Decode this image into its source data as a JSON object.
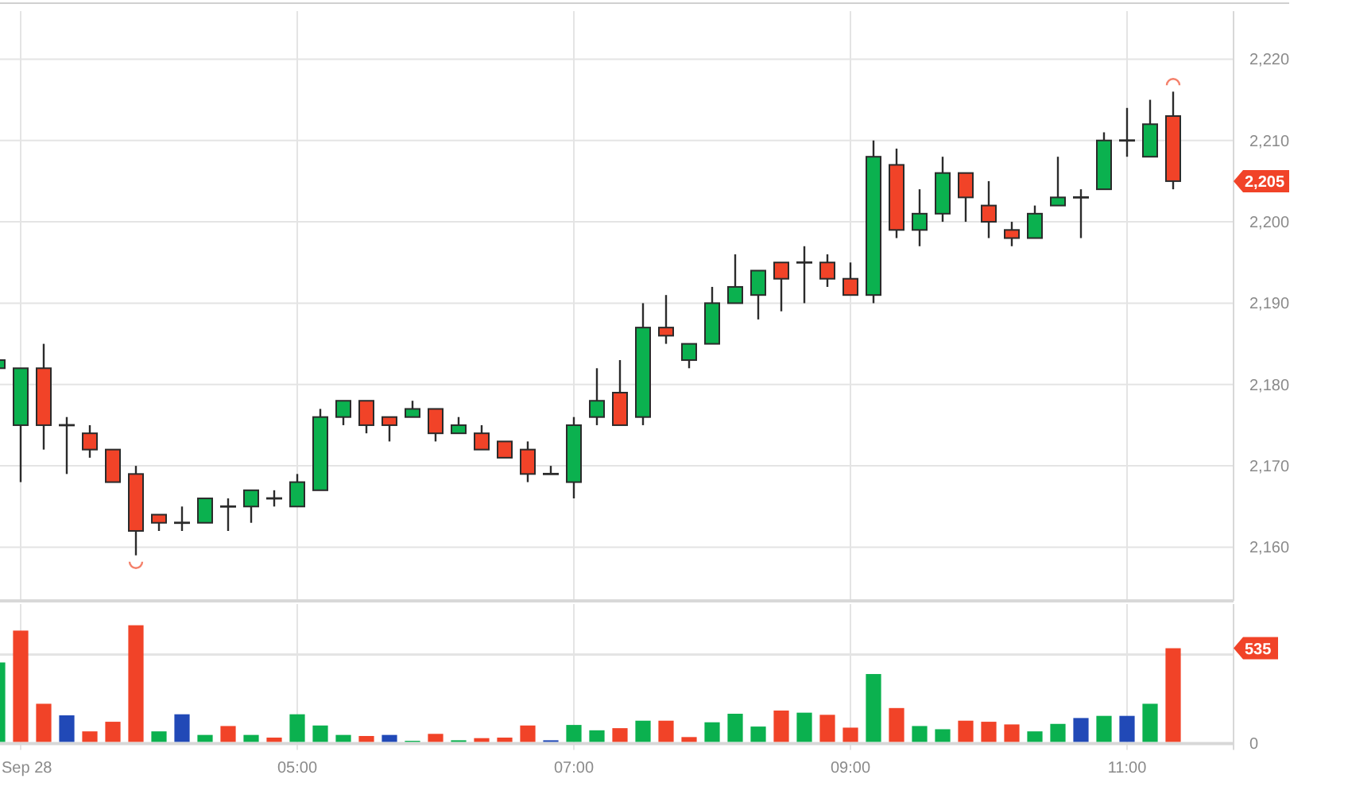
{
  "price_panel": {
    "last_price_tag": "2,205",
    "chart_data": {
      "type": "candlestick",
      "grid": true,
      "ylim": [
        2153.4,
        2225.9
      ],
      "yticks": [
        {
          "value": 2160,
          "label": "2,160"
        },
        {
          "value": 2170,
          "label": "2,170"
        },
        {
          "value": 2180,
          "label": "2,180"
        },
        {
          "value": 2190,
          "label": "2,190"
        },
        {
          "value": 2200,
          "label": "2,200"
        },
        {
          "value": 2210,
          "label": "2,210"
        },
        {
          "value": 2220,
          "label": "2,220"
        }
      ],
      "categories": [
        null,
        null,
        null,
        null,
        null,
        null,
        null,
        null,
        null,
        null,
        null,
        null,
        null,
        null,
        null,
        null,
        null,
        null,
        null,
        null,
        null,
        null,
        null,
        null,
        null,
        null,
        null,
        null,
        null,
        null,
        null,
        null,
        null,
        null,
        null,
        null,
        null,
        null,
        null,
        null,
        null,
        null,
        null,
        null,
        null,
        null,
        null,
        null,
        null,
        null,
        null,
        null
      ],
      "ohlc": [
        [
          2182,
          2183,
          2182,
          2183
        ],
        [
          2175,
          2182,
          2168,
          2182
        ],
        [
          2182,
          2185,
          2172,
          2175
        ],
        [
          2175,
          2176,
          2169,
          2175
        ],
        [
          2174,
          2175,
          2171,
          2172
        ],
        [
          2172,
          2172,
          2168,
          2168
        ],
        [
          2169,
          2170,
          2159,
          2162
        ],
        [
          2164,
          2164,
          2162,
          2163
        ],
        [
          2163,
          2165,
          2162,
          2163
        ],
        [
          2163,
          2166,
          2163,
          2166
        ],
        [
          2165,
          2166,
          2162,
          2165
        ],
        [
          2165,
          2167,
          2163,
          2167
        ],
        [
          2166,
          2167,
          2165,
          2166
        ],
        [
          2165,
          2169,
          2165,
          2168
        ],
        [
          2167,
          2177,
          2167,
          2176
        ],
        [
          2176,
          2178,
          2175,
          2178
        ],
        [
          2178,
          2178,
          2174,
          2175
        ],
        [
          2176,
          2176,
          2173,
          2175
        ],
        [
          2176,
          2178,
          2176,
          2177
        ],
        [
          2177,
          2177,
          2173,
          2174
        ],
        [
          2174,
          2176,
          2174,
          2175
        ],
        [
          2174,
          2175,
          2172,
          2172
        ],
        [
          2173,
          2173,
          2171,
          2171
        ],
        [
          2172,
          2173,
          2168,
          2169
        ],
        [
          2169,
          2170,
          2169,
          2169
        ],
        [
          2168,
          2176,
          2166,
          2175
        ],
        [
          2176,
          2182,
          2175,
          2178
        ],
        [
          2179,
          2183,
          2175,
          2175
        ],
        [
          2176,
          2190,
          2175,
          2187
        ],
        [
          2187,
          2191,
          2185,
          2186
        ],
        [
          2183,
          2185,
          2182,
          2185
        ],
        [
          2185,
          2192,
          2185,
          2190
        ],
        [
          2190,
          2196,
          2190,
          2192
        ],
        [
          2191,
          2194,
          2188,
          2194
        ],
        [
          2195,
          2195,
          2189,
          2193
        ],
        [
          2195,
          2197,
          2190,
          2195
        ],
        [
          2195,
          2196,
          2192,
          2193
        ],
        [
          2193,
          2195,
          2191,
          2191
        ],
        [
          2191,
          2210,
          2190,
          2208
        ],
        [
          2207,
          2209,
          2198,
          2199
        ],
        [
          2199,
          2204,
          2197,
          2201
        ],
        [
          2201,
          2208,
          2200,
          2206
        ],
        [
          2206,
          2206,
          2200,
          2203
        ],
        [
          2202,
          2205,
          2198,
          2200
        ],
        [
          2199,
          2200,
          2197,
          2198
        ],
        [
          2198,
          2202,
          2198,
          2201
        ],
        [
          2202,
          2208,
          2202,
          2203
        ],
        [
          2203,
          2204,
          2198,
          2203
        ],
        [
          2204,
          2211,
          2204,
          2210
        ],
        [
          2210,
          2214,
          2208,
          2210
        ],
        [
          2208,
          2215,
          2208,
          2212
        ],
        [
          2213,
          2216,
          2204,
          2205
        ]
      ]
    }
  },
  "volume_panel": {
    "chart_data": {
      "type": "bar",
      "stacked": true,
      "grid": true,
      "ylim": [
        0,
        783
      ],
      "yticks": [
        {
          "value": 0,
          "label": "0"
        },
        {
          "value": 535,
          "label": "535"
        }
      ],
      "ref_lines": [
        {
          "axis": "y",
          "value": 500
        }
      ],
      "categories": [
        null,
        "Sep 28",
        null,
        null,
        null,
        null,
        null,
        null,
        null,
        null,
        null,
        null,
        null,
        "05:00",
        null,
        null,
        null,
        null,
        null,
        null,
        null,
        null,
        null,
        null,
        null,
        "07:00",
        null,
        null,
        null,
        null,
        null,
        null,
        null,
        null,
        null,
        null,
        null,
        "09:00",
        null,
        null,
        null,
        null,
        null,
        null,
        null,
        null,
        null,
        null,
        null,
        "11:00",
        null,
        null
      ],
      "series": [
        {
          "color": "#0bb14f",
          "values": [
            455,
            null,
            null,
            null,
            null,
            null,
            null,
            68,
            null,
            48,
            null,
            48,
            null,
            164,
            101,
            48,
            null,
            null,
            15,
            null,
            18,
            null,
            null,
            null,
            null,
            104,
            74,
            null,
            128,
            null,
            null,
            119,
            167,
            95,
            null,
            173,
            null,
            null,
            390,
            null,
            98,
            80,
            null,
            null,
            null,
            68,
            110,
            null,
            155,
            null,
            223,
            null
          ]
        },
        {
          "color": "#f14328",
          "values": [
            null,
            634,
            223,
            null,
            68,
            122,
            664,
            null,
            null,
            null,
            98,
            null,
            33,
            null,
            null,
            null,
            42,
            null,
            null,
            54,
            null,
            30,
            33,
            101,
            null,
            null,
            null,
            86,
            null,
            128,
            36,
            null,
            null,
            null,
            185,
            null,
            161,
            89,
            null,
            199,
            null,
            null,
            128,
            122,
            107,
            null,
            null,
            null,
            null,
            null,
            null,
            535
          ]
        },
        {
          "color": "#2149b7",
          "values": [
            null,
            null,
            null,
            158,
            null,
            null,
            null,
            null,
            164,
            null,
            null,
            null,
            null,
            null,
            null,
            null,
            null,
            48,
            null,
            null,
            null,
            null,
            null,
            null,
            18,
            null,
            null,
            null,
            null,
            null,
            null,
            null,
            null,
            null,
            null,
            null,
            null,
            null,
            null,
            null,
            null,
            null,
            null,
            null,
            null,
            null,
            null,
            143,
            null,
            155,
            null,
            null
          ]
        }
      ]
    }
  }
}
